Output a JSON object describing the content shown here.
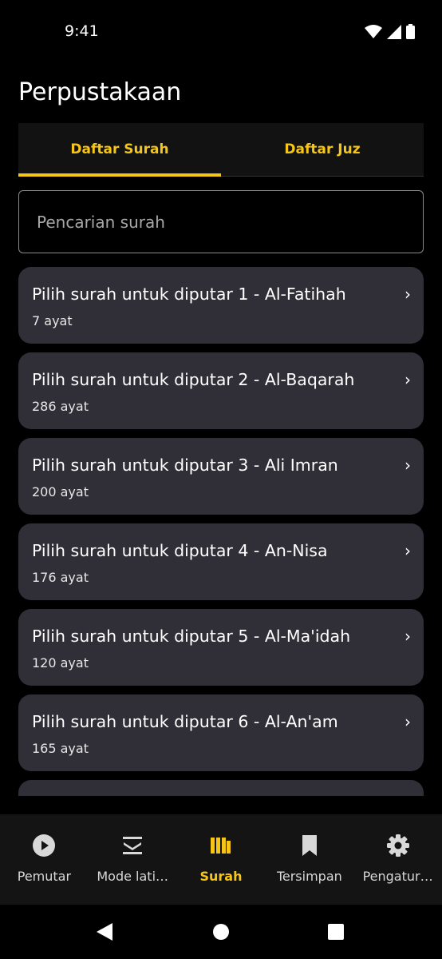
{
  "status": {
    "time": "9:41"
  },
  "page_title": "Perpustakaan",
  "tabs": [
    {
      "label": "Daftar Surah",
      "active": true
    },
    {
      "label": "Daftar Juz",
      "active": false
    }
  ],
  "search": {
    "placeholder": "Pencarian surah",
    "value": ""
  },
  "surahs": [
    {
      "title": "Pilih surah untuk diputar 1 - Al-Fatihah",
      "verses": "7 ayat"
    },
    {
      "title": "Pilih surah untuk diputar 2 - Al-Baqarah",
      "verses": "286 ayat"
    },
    {
      "title": "Pilih surah untuk diputar 3 - Ali Imran",
      "verses": "200 ayat"
    },
    {
      "title": "Pilih surah untuk diputar 4 - An-Nisa",
      "verses": "176 ayat"
    },
    {
      "title": "Pilih surah untuk diputar 5 - Al-Ma'idah",
      "verses": "120 ayat"
    },
    {
      "title": "Pilih surah untuk diputar 6 - Al-An'am",
      "verses": "165 ayat"
    }
  ],
  "chevron": "›",
  "bottom_nav": [
    {
      "label": "Pemutar",
      "icon": "play-circle-icon",
      "active": false
    },
    {
      "label": "Mode lati…",
      "icon": "layers-icon",
      "active": false
    },
    {
      "label": "Surah",
      "icon": "library-icon",
      "active": true
    },
    {
      "label": "Tersimpan",
      "icon": "bookmark-icon",
      "active": false
    },
    {
      "label": "Pengatur…",
      "icon": "settings-icon",
      "active": false
    }
  ],
  "colors": {
    "accent": "#f5c518",
    "card": "#302f37",
    "background": "#000000",
    "nav_bg": "#141414"
  }
}
